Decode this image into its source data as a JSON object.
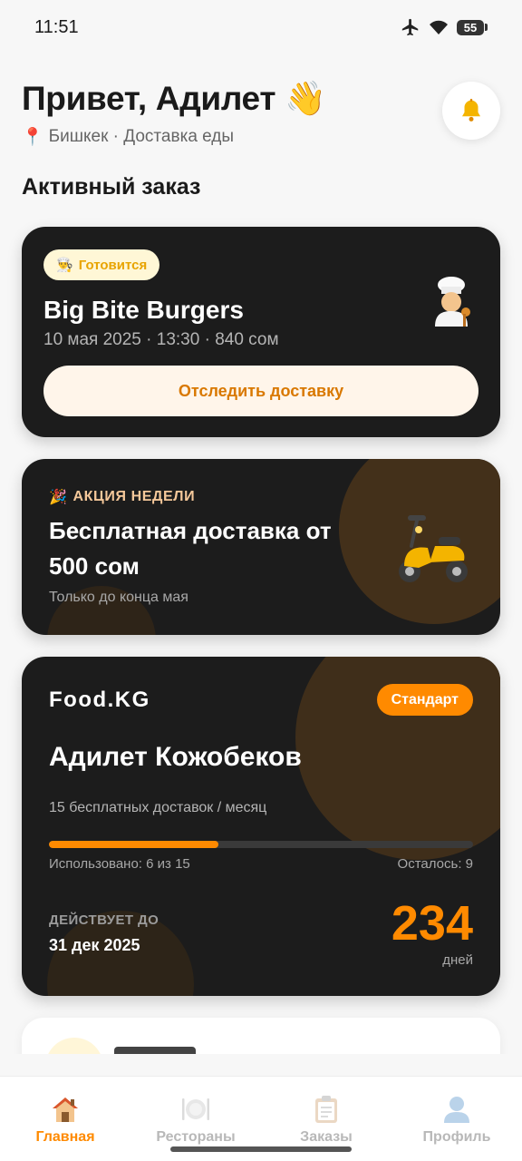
{
  "status_bar": {
    "time": "11:51",
    "battery": "55"
  },
  "header": {
    "greeting": "Привет, Адилет 👋",
    "location_pin": "📍",
    "location": "Бишкек · Доставка еды"
  },
  "section": {
    "active_order_title": "Активный заказ"
  },
  "order": {
    "status_emoji": "👨‍🍳",
    "status": "Готовится",
    "restaurant": "Big Bite Burgers",
    "meta": "10 мая 2025 · 13:30 · 840 сом",
    "track_label": "Отследить доставку"
  },
  "promo": {
    "tag_emoji": "🎉",
    "tag": "АКЦИЯ НЕДЕЛИ",
    "title": "Бесплатная доставка от 500 сом",
    "subtitle": "Только до конца мая"
  },
  "subscription": {
    "brand": "Food.KG",
    "plan": "Стандарт",
    "holder": "Адилет Кожобеков",
    "description": "15 бесплатных доставок / месяц",
    "used_text": "Использовано: 6 из 15",
    "left_text": "Осталось: 9",
    "progress_fraction": 0.4,
    "valid_label": "ДЕЙСТВУЕТ ДО",
    "valid_date": "31 дек 2025",
    "days_count": "234",
    "days_label": "дней"
  },
  "nav": {
    "items": [
      {
        "label": "Главная",
        "icon": "home-icon",
        "active": true
      },
      {
        "label": "Рестораны",
        "icon": "plate-icon",
        "active": false
      },
      {
        "label": "Заказы",
        "icon": "clipboard-icon",
        "active": false
      },
      {
        "label": "Профиль",
        "icon": "profile-icon",
        "active": false
      }
    ]
  },
  "colors": {
    "accent": "#ff8a00",
    "card_dark": "#1c1c1c",
    "background": "#f7f7f7"
  }
}
